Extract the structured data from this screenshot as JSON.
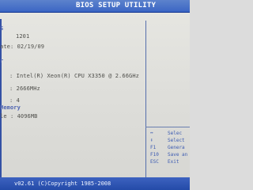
{
  "window": {
    "title": "BIOS SETUP UTILITY"
  },
  "bios_info": {
    "version_fragment": "1201",
    "date_fragment": "ate: 02/19/09",
    "section_fragment": "S"
  },
  "processor": {
    "section_fragment": "r",
    "cpu_line": ": Intel(R) Xeon(R) CPU X3350 @ 2.66GHz",
    "speed_line": ": 2666MHz",
    "count_line": ": 4"
  },
  "memory": {
    "section_label": "Memory",
    "size_line": "le : 4096MB"
  },
  "help": {
    "items": [
      {
        "key": "↔",
        "desc": "Selec"
      },
      {
        "key": "↕",
        "desc": "Select"
      },
      {
        "key": "F1",
        "desc": "Genera"
      },
      {
        "key": "F10",
        "desc": "Save an"
      },
      {
        "key": "ESC",
        "desc": "Exit"
      }
    ]
  },
  "footer": {
    "text": "v02.61 (C)Copyright 1985-2008"
  },
  "colors": {
    "title_bg": "#3b66c4",
    "accent": "#4b61b0",
    "text": "#4f4f4b",
    "screen_bg": "#dfdfdb"
  }
}
